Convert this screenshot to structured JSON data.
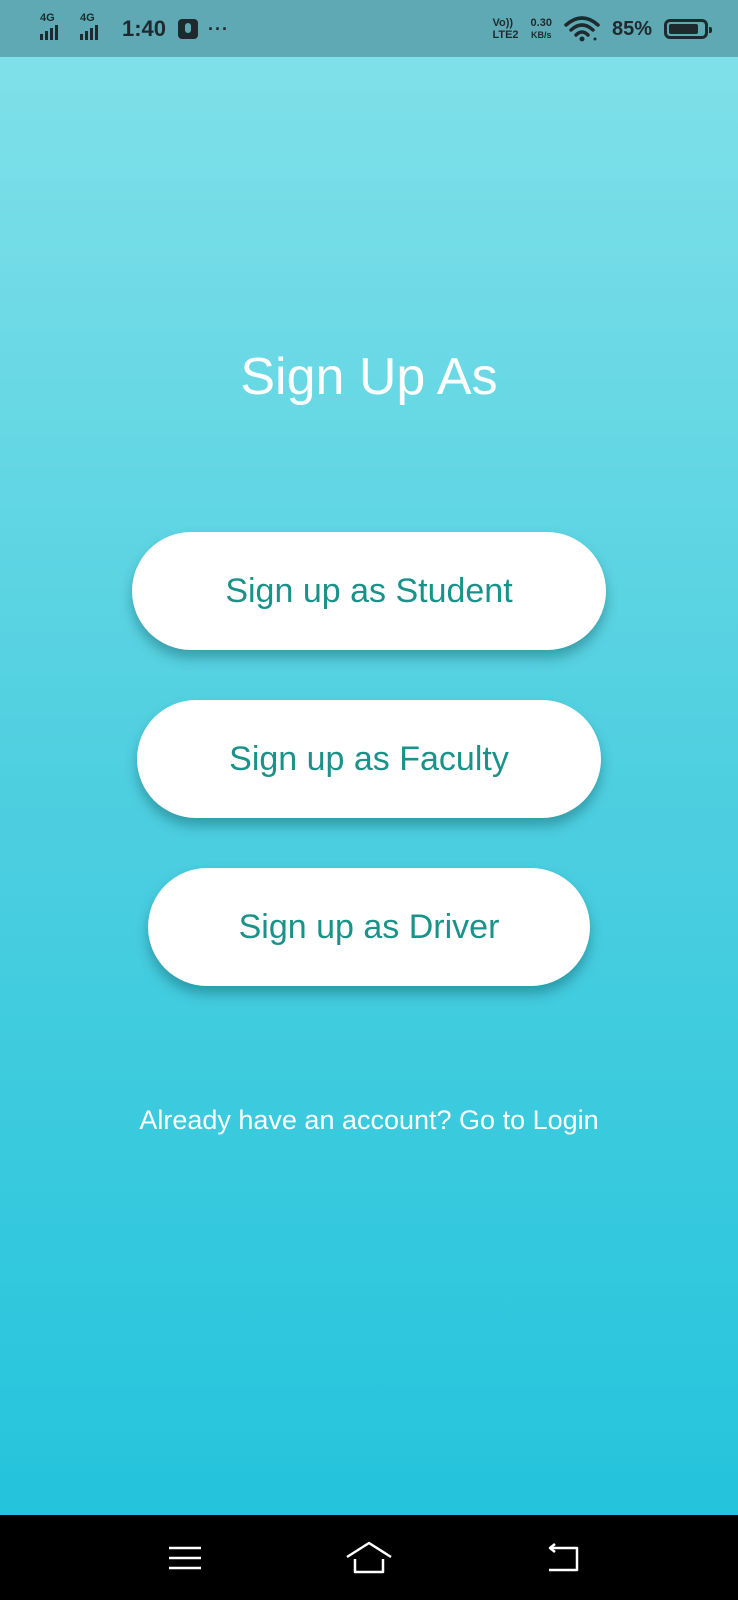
{
  "status_bar": {
    "signal1_label": "4G",
    "signal2_label": "4G",
    "time": "1:40",
    "more_indicator": "···",
    "volte_top": "Vo))",
    "volte_bottom": "LTE2",
    "net_speed": "0.30",
    "net_speed_unit": "KB/s",
    "battery_percent": "85%",
    "battery_level": 0.85,
    "icons": [
      "signal-icon",
      "mic-icon",
      "wifi-icon",
      "battery-icon"
    ]
  },
  "main": {
    "title": "Sign Up As",
    "buttons": [
      {
        "label": "Sign up as Student"
      },
      {
        "label": "Sign up as Faculty"
      },
      {
        "label": "Sign up as Driver"
      }
    ],
    "login_link": "Already have an account? Go to Login"
  },
  "nav_bar": {
    "icons": [
      "menu-icon",
      "home-icon",
      "back-icon"
    ]
  },
  "colors": {
    "gradient_top": "#7fe0e9",
    "gradient_bottom": "#24c4dc",
    "button_text": "#199389",
    "status_bar": "#5fa9b4"
  }
}
